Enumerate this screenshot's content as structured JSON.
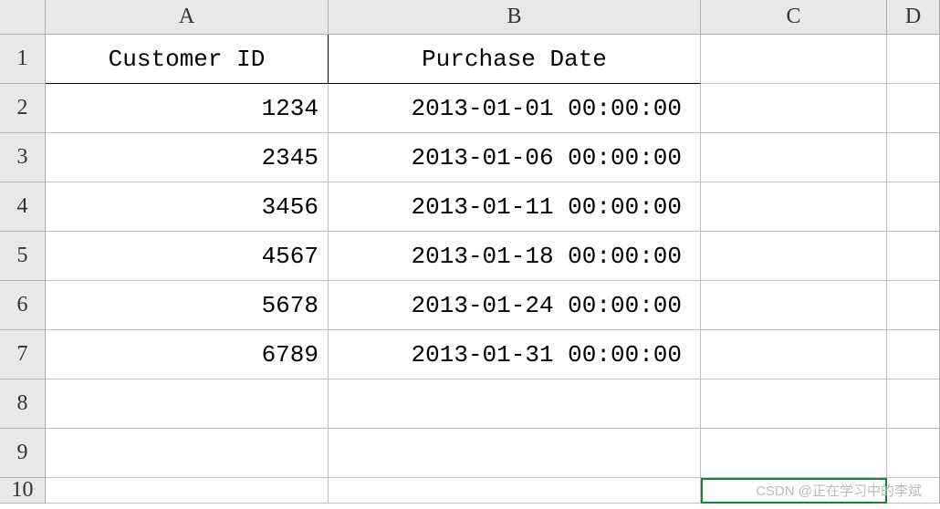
{
  "columns": [
    "A",
    "B",
    "C",
    "D"
  ],
  "rows": [
    "1",
    "2",
    "3",
    "4",
    "5",
    "6",
    "7",
    "8",
    "9",
    "10"
  ],
  "headers": {
    "a": "Customer ID",
    "b": "Purchase Date"
  },
  "data": [
    {
      "id": "1234",
      "date": "2013-01-01 00:00:00"
    },
    {
      "id": "2345",
      "date": "2013-01-06 00:00:00"
    },
    {
      "id": "3456",
      "date": "2013-01-11 00:00:00"
    },
    {
      "id": "4567",
      "date": "2013-01-18 00:00:00"
    },
    {
      "id": "5678",
      "date": "2013-01-24 00:00:00"
    },
    {
      "id": "6789",
      "date": "2013-01-31 00:00:00"
    }
  ],
  "watermark": "CSDN @正在学习中的李斌",
  "selected_cell": "C10"
}
